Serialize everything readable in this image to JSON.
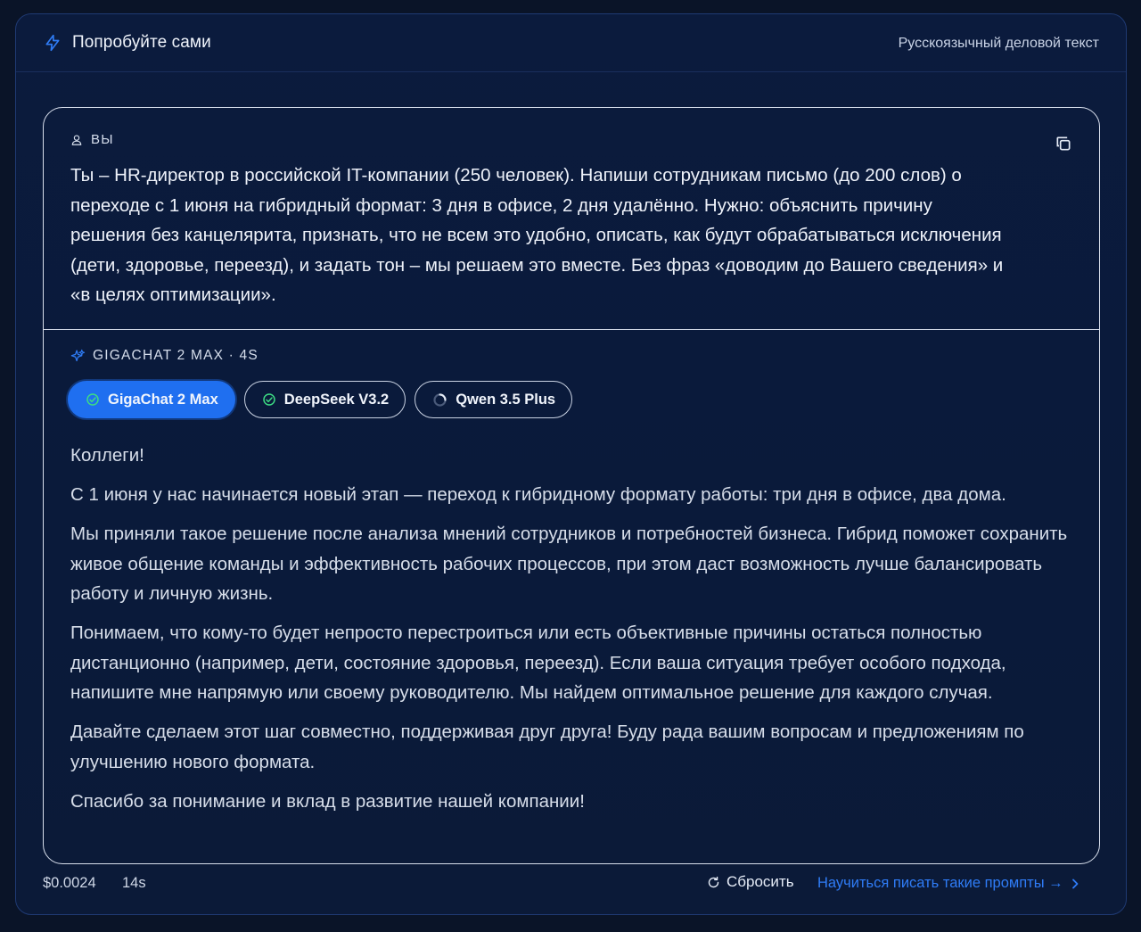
{
  "header": {
    "title": "Попробуйте сами",
    "subtitle": "Русскоязычный деловой текст"
  },
  "user": {
    "role_label": "ВЫ",
    "prompt": "Ты – HR-директор в российской IT-компании (250 человек). Напиши сотрудникам письмо (до 200 слов) о переходе с 1 июня на гибридный формат: 3 дня в офисе, 2 дня удалённо. Нужно: объяснить причину решения без канцелярита, признать, что не всем это удобно, описать, как будут обрабатываться исключения (дети, здоровье, переезд), и задать тон – мы решаем это вместе. Без фраз «доводим до Вашего сведения» и «в целях оптимизации»."
  },
  "answer": {
    "model_label": "GIGACHAT 2 MAX · 4S",
    "tabs": [
      {
        "label": "GigaChat 2 Max",
        "status": "done",
        "active": true
      },
      {
        "label": "DeepSeek V3.2",
        "status": "done",
        "active": false
      },
      {
        "label": "Qwen 3.5 Plus",
        "status": "loading",
        "active": false
      }
    ],
    "paragraphs": [
      "Коллеги!",
      "С 1 июня у нас начинается новый этап — переход к гибридному формату работы: три дня в офисе, два дома.",
      "Мы приняли такое решение после анализа мнений сотрудников и потребностей бизнеса. Гибрид поможет сохранить живое общение команды и эффективность рабочих процессов, при этом даст возможность лучше балансировать работу и личную жизнь.",
      "Понимаем, что кому-то будет непросто перестроиться или есть объективные причины остаться полностью дистанционно (например, дети, состояние здоровья, переезд). Если ваша ситуация требует особого подхода, напишите мне напрямую или своему руководителю. Мы найдем оптимальное решение для каждого случая.",
      "Давайте сделаем этот шаг совместно, поддерживая друг друга! Буду рада вашим вопросам и предложениям по улучшению нового формата.",
      "Спасибо за понимание и вклад в развитие нашей компании!"
    ]
  },
  "footer": {
    "cost": "$0.0024",
    "time": "14s",
    "reset_label": "Сбросить",
    "learn_label": "Научиться писать такие промпты →"
  },
  "colors": {
    "background": "#0a1428",
    "panel": "#0b1b3d",
    "accent": "#1f6ff0",
    "link": "#2f7cf6",
    "success": "#3ddc84"
  }
}
